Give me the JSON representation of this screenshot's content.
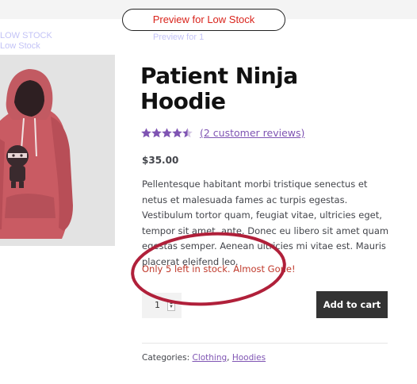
{
  "banner": {
    "preview_label": "Preview for Low Stock",
    "ghost_left_1": "LOW STOCK",
    "ghost_left_2": "Low Stock",
    "ghost_center": "Preview for 1"
  },
  "product": {
    "title_line1": "Patient Ninja",
    "title_line2": "Hoodie",
    "rating": 4.5,
    "rating_max": 5,
    "review_link": "(2 customer reviews)",
    "price": "$35.00",
    "description": "Pellentesque habitant morbi tristique senectus et netus et malesuada fames ac turpis egestas. Vestibulum tortor quam, feugiat vitae, ultricies eget, tempor sit amet, ante. Donec eu libero sit amet quam egestas semper. Aenean ultricies mi vitae est. Mauris placerat eleifend leo.",
    "stock_message": "Only 5 left in stock. Almost Gone!",
    "quantity": "1",
    "add_to_cart": "Add to cart",
    "categories_label": "Categories:",
    "category_1": "Clothing",
    "category_sep": ",",
    "category_2": "Hoodies"
  },
  "colors": {
    "accent": "#7f54b3",
    "stock": "#c0392b",
    "annotation": "#b0203a",
    "button": "#333333",
    "image_bg": "#e3e3e3",
    "hoodie": "#c95b63"
  },
  "icons": {
    "star": "star-icon",
    "quantity_spinner": "spinner-icon"
  }
}
